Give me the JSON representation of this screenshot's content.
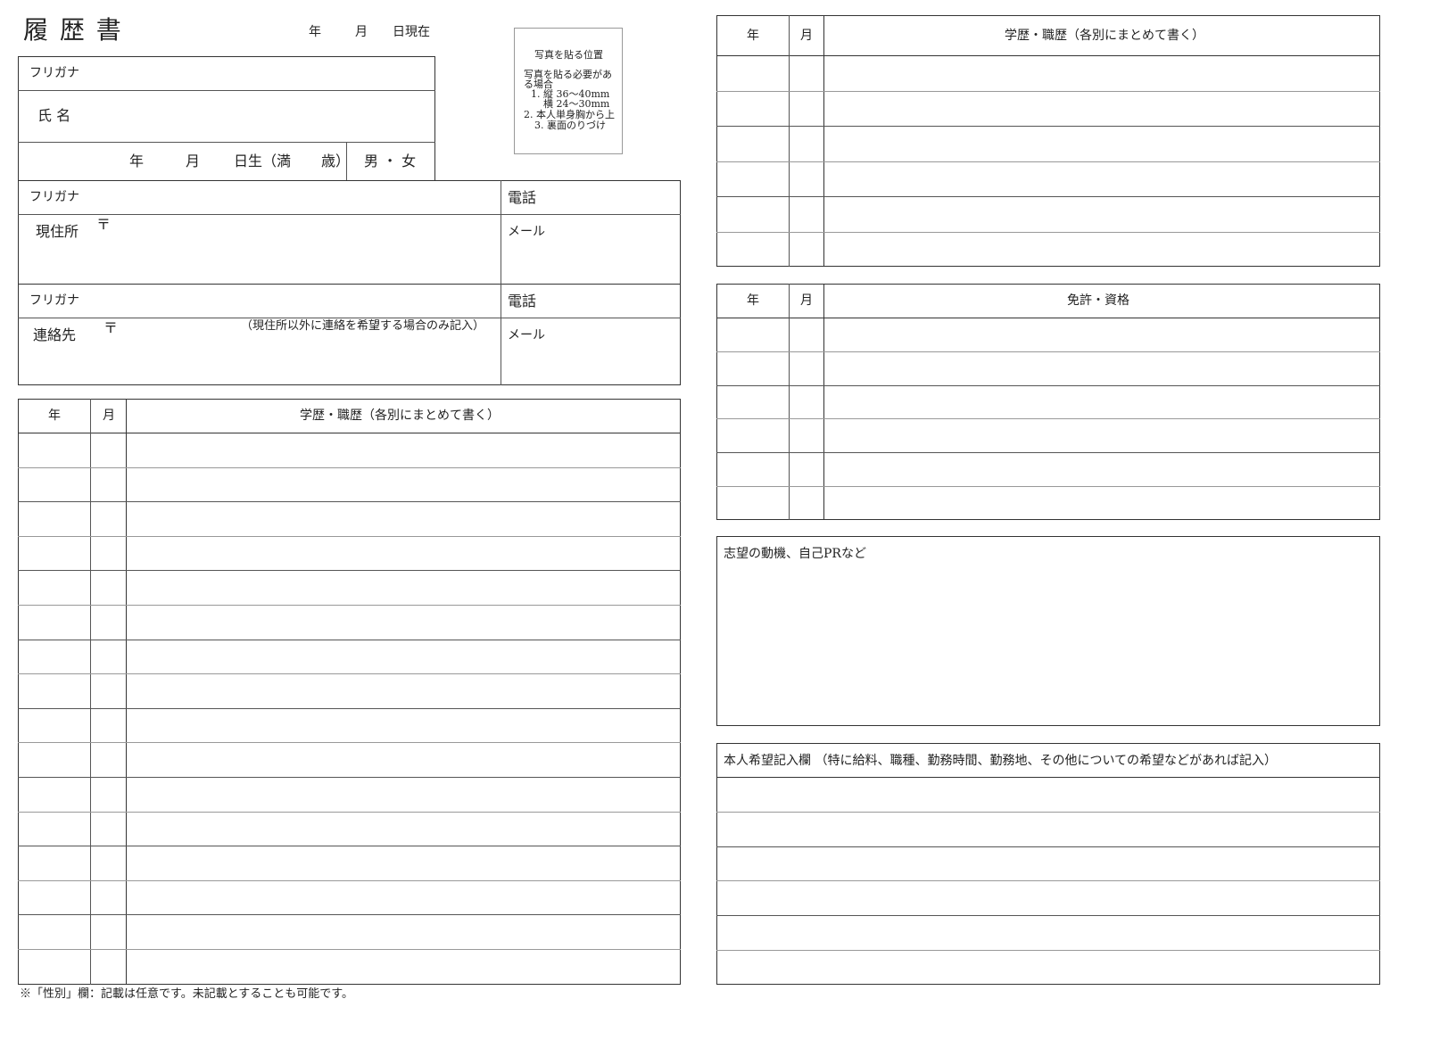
{
  "header": {
    "title": "履 歴 書",
    "date_year": "年",
    "date_month": "月",
    "date_suffix": "日現在"
  },
  "photo": {
    "title": "写真を貼る位置",
    "line1": "写真を貼る必要があ",
    "line2": "る場合",
    "line3": "1. 縦 36〜40mm",
    "line4": "横 24〜30mm",
    "line5": "2. 本人単身胸から上",
    "line6": "3. 裏面のりづけ"
  },
  "personal": {
    "furigana": "フリガナ",
    "name_label": "氏 名",
    "birth_year": "年",
    "birth_month": "月",
    "birth_day": "日生（満",
    "birth_age": "歳）",
    "gender": "男 ・ 女"
  },
  "address": {
    "furigana": "フリガナ",
    "label": "現住所",
    "postal": "〒",
    "phone": "電話",
    "mail": "メール"
  },
  "contact": {
    "furigana": "フリガナ",
    "label": "連絡先",
    "postal": "〒",
    "note": "（現住所以外に連絡を希望する場合のみ記入）",
    "phone": "電話",
    "mail": "メール"
  },
  "history_left": {
    "col_year": "年",
    "col_month": "月",
    "col_content": "学歴・職歴（各別にまとめて書く）"
  },
  "history_right": {
    "col_year": "年",
    "col_month": "月",
    "col_content": "学歴・職歴（各別にまとめて書く）"
  },
  "license": {
    "col_year": "年",
    "col_month": "月",
    "col_content": "免許・資格"
  },
  "motivation": {
    "label": "志望の動機、自己PRなど"
  },
  "wishes": {
    "label": "本人希望記入欄 （特に給料、職種、勤務時間、勤務地、その他についての希望などがあれば記入）"
  },
  "footer": {
    "note": "※「性別」欄：記載は任意です。未記載とすることも可能です。"
  }
}
